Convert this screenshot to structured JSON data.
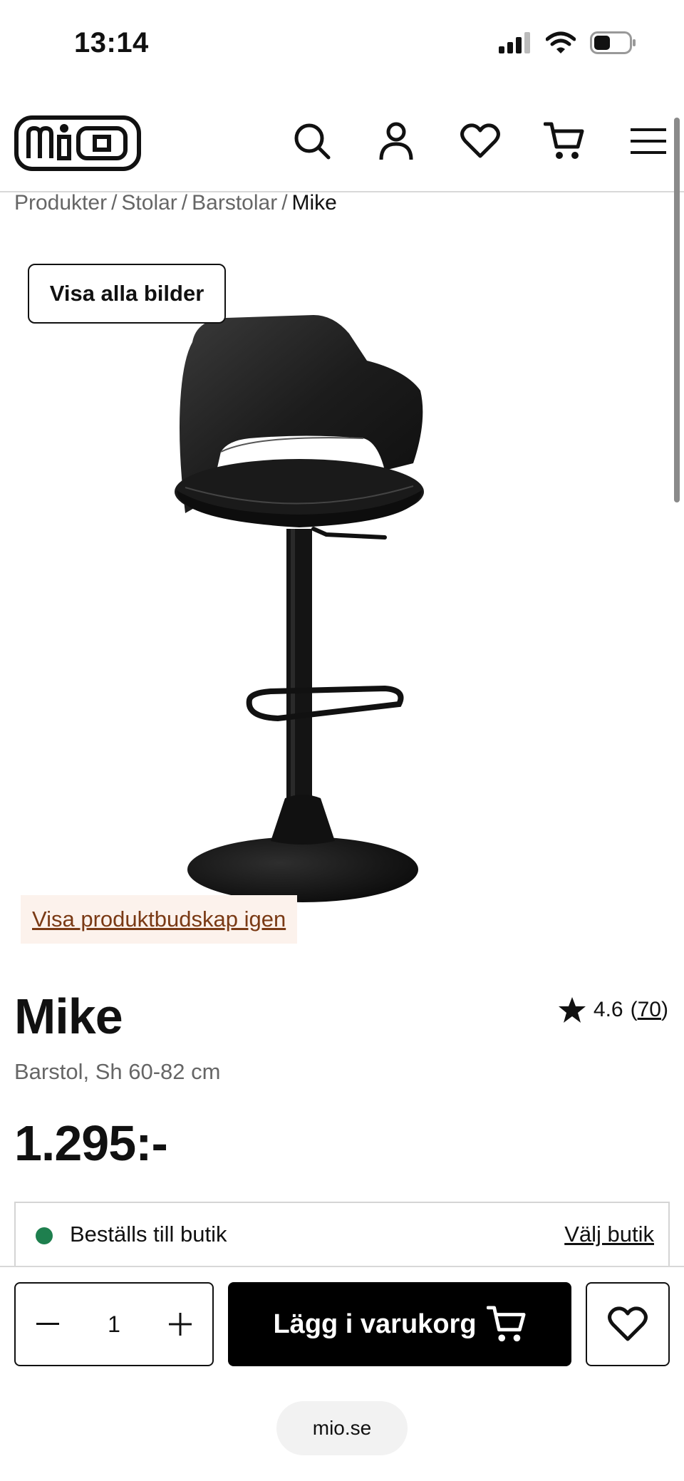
{
  "status_bar": {
    "time": "13:14"
  },
  "header": {
    "logo_text": "mio",
    "icons": [
      "search-icon",
      "user-icon",
      "heart-icon",
      "cart-icon",
      "menu-icon"
    ]
  },
  "breadcrumb": [
    "Produkter",
    "Stolar",
    "Barstolar",
    "Mike"
  ],
  "gallery": {
    "show_all_label": "Visa alla bilder",
    "message_link": "Visa produktbudskap igen"
  },
  "product": {
    "name": "Mike",
    "subtitle": "Barstol, Sh 60-82 cm",
    "price": "1.295:-",
    "rating": "4.6",
    "review_count": "70"
  },
  "stock": {
    "status": "Beställs till butik",
    "status_color": "#1e7f4e",
    "store_link": "Välj butik"
  },
  "buy_bar": {
    "quantity": "1",
    "add_to_cart_label": "Lägg i varukorg"
  },
  "browser": {
    "url": "mio.se"
  }
}
